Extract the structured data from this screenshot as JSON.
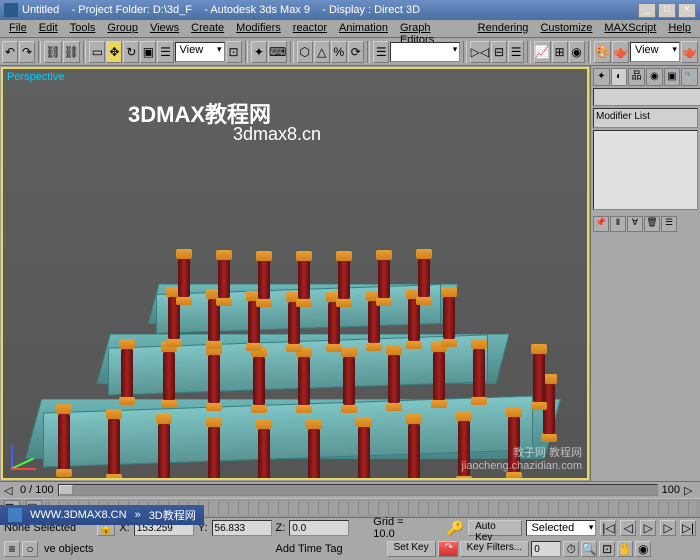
{
  "title": {
    "untitled": "Untitled",
    "folder": "- Project Folder: D:\\3d_F",
    "app": "- Autodesk 3ds Max 9",
    "display": "- Display : Direct 3D"
  },
  "menu": [
    "File",
    "Edit",
    "Tools",
    "Group",
    "Views",
    "Create",
    "Modifiers",
    "reactor",
    "Animation",
    "Graph Editors",
    "Rendering",
    "Customize",
    "MAXScript",
    "Help"
  ],
  "toolbar": {
    "view_dd": "View",
    "view_dd2": "View"
  },
  "viewport": {
    "label": "Perspective",
    "wm1": "3DMAX教程网",
    "wm2": "3dmax8.cn",
    "wm3a": "教子网 教程网",
    "wm3b": "jiaocheng.chazidian.com"
  },
  "cmdpanel": {
    "modlist": "Modifier List"
  },
  "status": {
    "frame": "0 / 100",
    "sel": "None Selected",
    "x": "153.259",
    "y": "56.833",
    "z": "0.0",
    "grid": "Grid = 10.0",
    "autokey": "Auto Key",
    "setkey": "Set Key",
    "selected": "Selected",
    "keyfilters": "Key Filters...",
    "addtag": "Add Time Tag",
    "objects": "ve objects",
    "framenum": "0",
    "end": "100"
  },
  "url": {
    "site": "WWW.3DMAX8.CN",
    "arrow": "»",
    "desc": "3D教程网"
  }
}
